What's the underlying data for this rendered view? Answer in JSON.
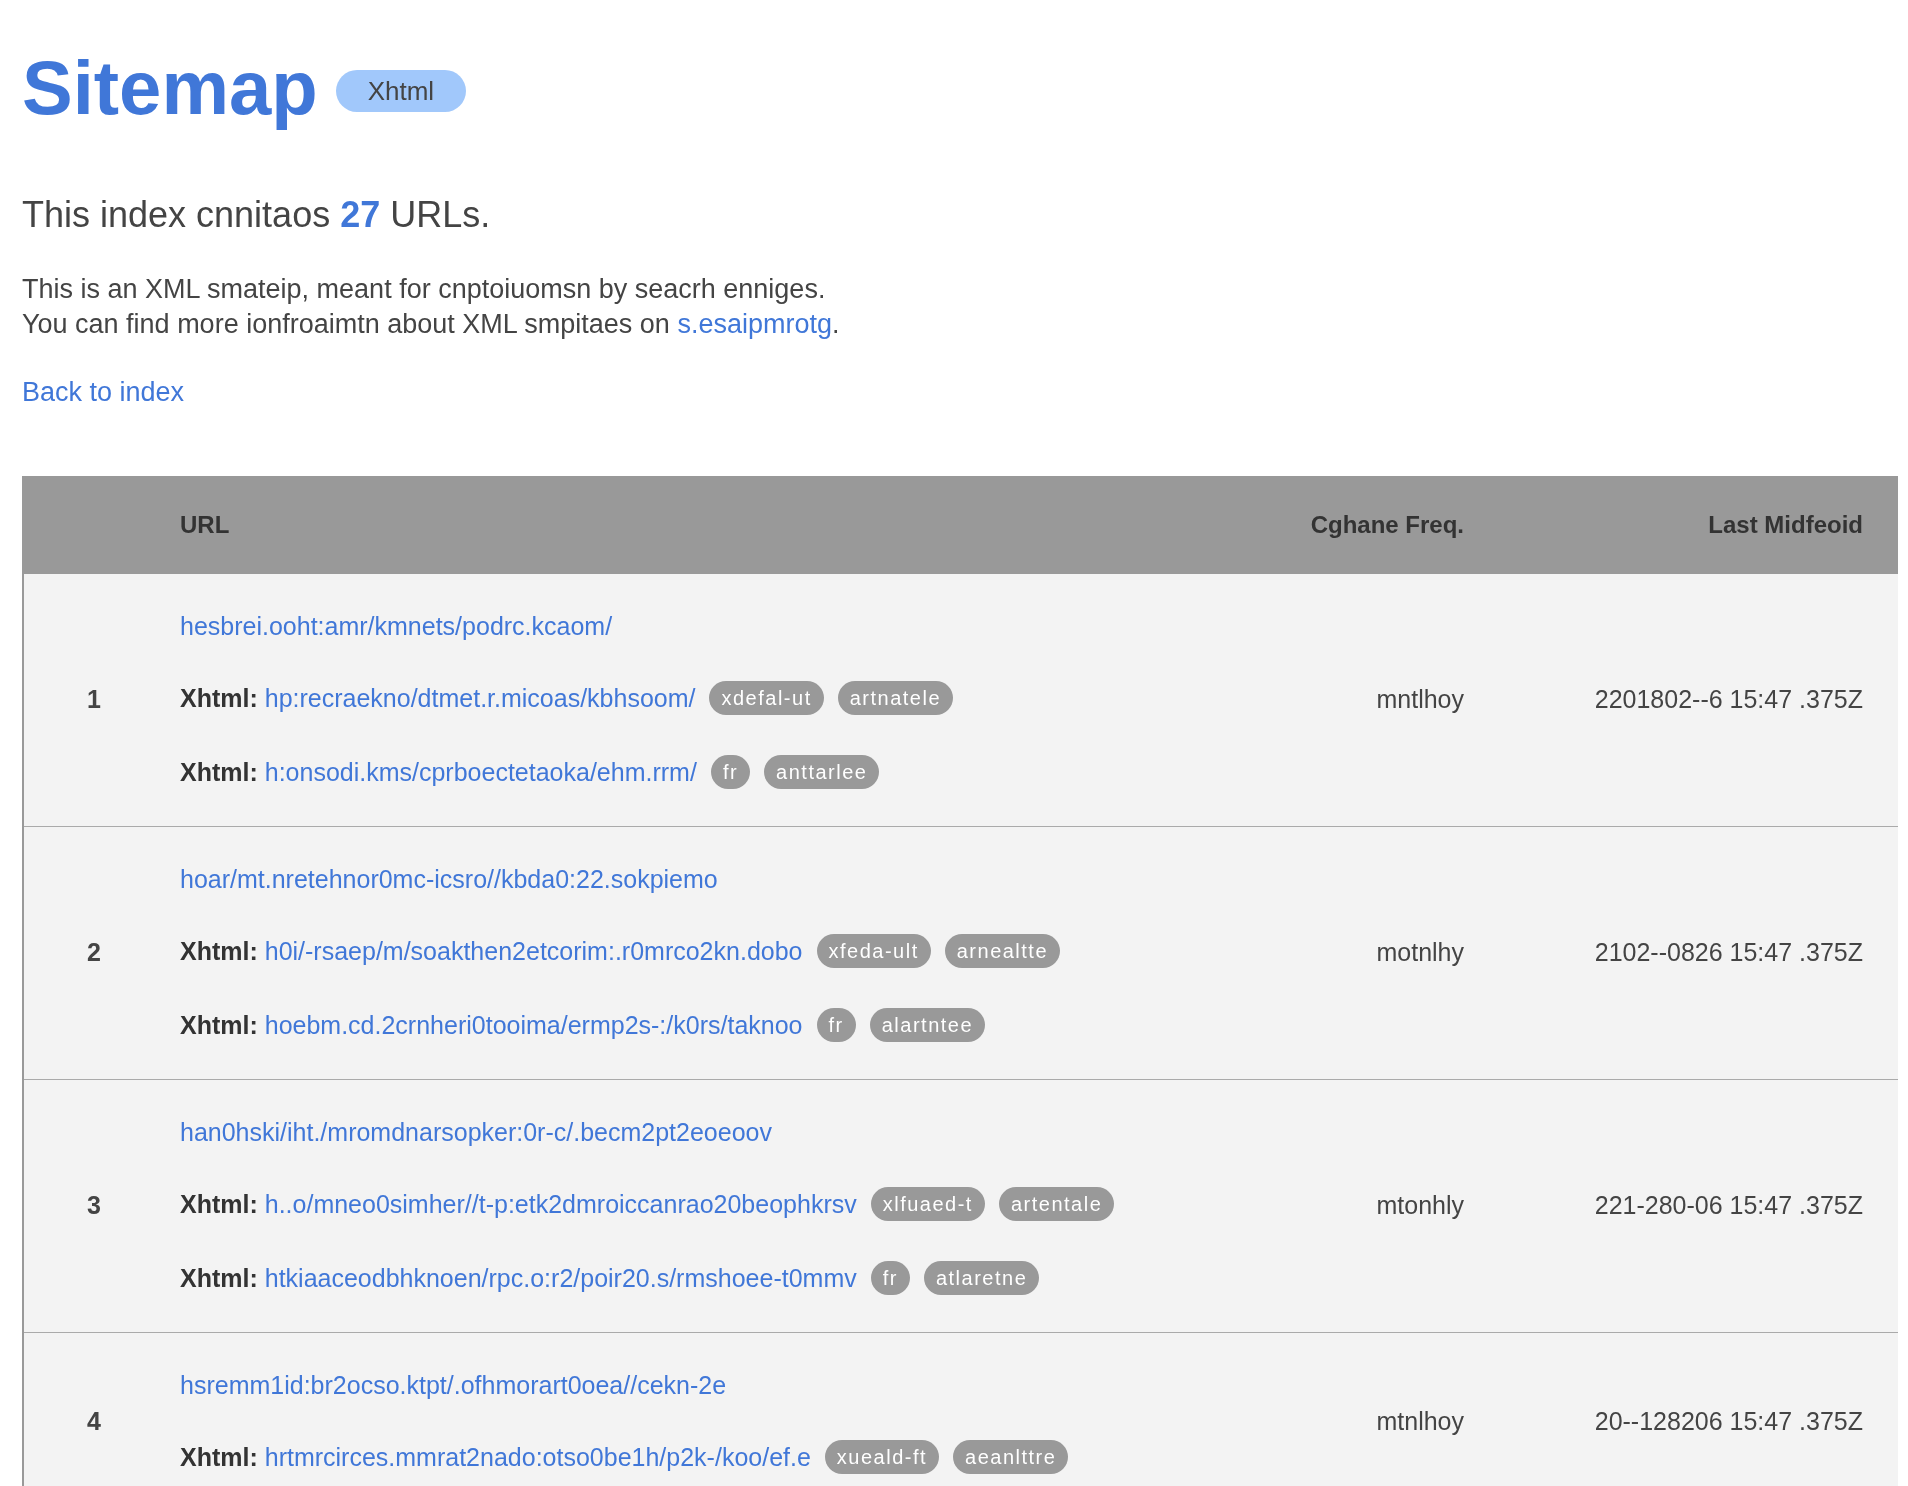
{
  "title": "Sitemap",
  "title_badge": "Xhtml",
  "summary": "This index cnnitaos **27** URLs.",
  "description": {
    "line_1": "This is an XML smateip, meant for cnptoiuomsn by seacrh enniges.",
    "line_2_before": "You can find more ionfroaimtn about XML smpitaes on ",
    "link": "s.esaipmrotg",
    "line_2_after": "."
  },
  "back_link": "Back to index",
  "table": {
    "columns": [
      "URL",
      "Cghane Freq.",
      "Last Midfeoid"
    ],
    "rows": [
      {
        "number": "1",
        "url": "hesbrei.ooht:amr/kmnets/podrc.kcaom/",
        "alternates": [
          {
            "label": "Xhtml:",
            "url": "hp:recraekno/dtmet.r.micoas/kbhsoom/",
            "tags": [
              "xdefal-ut",
              "artnatele"
            ]
          },
          {
            "label": "Xhtml:",
            "url": "h:onsodi.kms/cprboectetaoka/ehm.rrm/",
            "tags": [
              "fr",
              "anttarlee"
            ]
          }
        ],
        "change_freq": "mntlhoy",
        "last_modified": "2201802--6 15:47 .375Z"
      },
      {
        "number": "2",
        "url": "hoar/mt.nretehnor0mc-icsro//kbda0:22.sokpiemo",
        "alternates": [
          {
            "label": "Xhtml:",
            "url": "h0i/-rsaep/m/soakthen2etcorim:.r0mrco2kn.dobo",
            "tags": [
              "xfeda-ult",
              "arnealtte"
            ]
          },
          {
            "label": "Xhtml:",
            "url": "hoebm.cd.2crnheri0tooima/ermp2s-:/k0rs/taknoo",
            "tags": [
              "fr",
              "alartntee"
            ]
          }
        ],
        "change_freq": "motnlhy",
        "last_modified": "2102--0826 15:47 .375Z"
      },
      {
        "number": "3",
        "url": "han0hski/iht./mromdnarsopker:0r-c/.becm2pt2eoeoov",
        "alternates": [
          {
            "label": "Xhtml:",
            "url": "h..o/mneo0simher//t-p:etk2dmroiccanrao20beophkrsv",
            "tags": [
              "xlfuaed-t",
              "artentale"
            ]
          },
          {
            "label": "Xhtml:",
            "url": "htkiaaceodbhknoen/rpc.o:r2/poir20.s/rmshoee-t0mmv",
            "tags": [
              "fr",
              "atlaretne"
            ]
          }
        ],
        "change_freq": "mtonhly",
        "last_modified": "221-280-06 15:47 .375Z"
      },
      {
        "number": "4",
        "url": "hsremm1id:br2ocso.ktpt/.ofhmorart0oea//cekn-2e",
        "alternates": [
          {
            "label": "Xhtml:",
            "url": "hrtmrcirces.mmrat2nado:otso0be1h/p2k-/koo/ef.e",
            "tags": [
              "xueald-ft",
              "aeanlttre"
            ]
          }
        ],
        "change_freq": "mtnlhoy",
        "last_modified": "20--128206 15:47 .375Z"
      }
    ]
  }
}
